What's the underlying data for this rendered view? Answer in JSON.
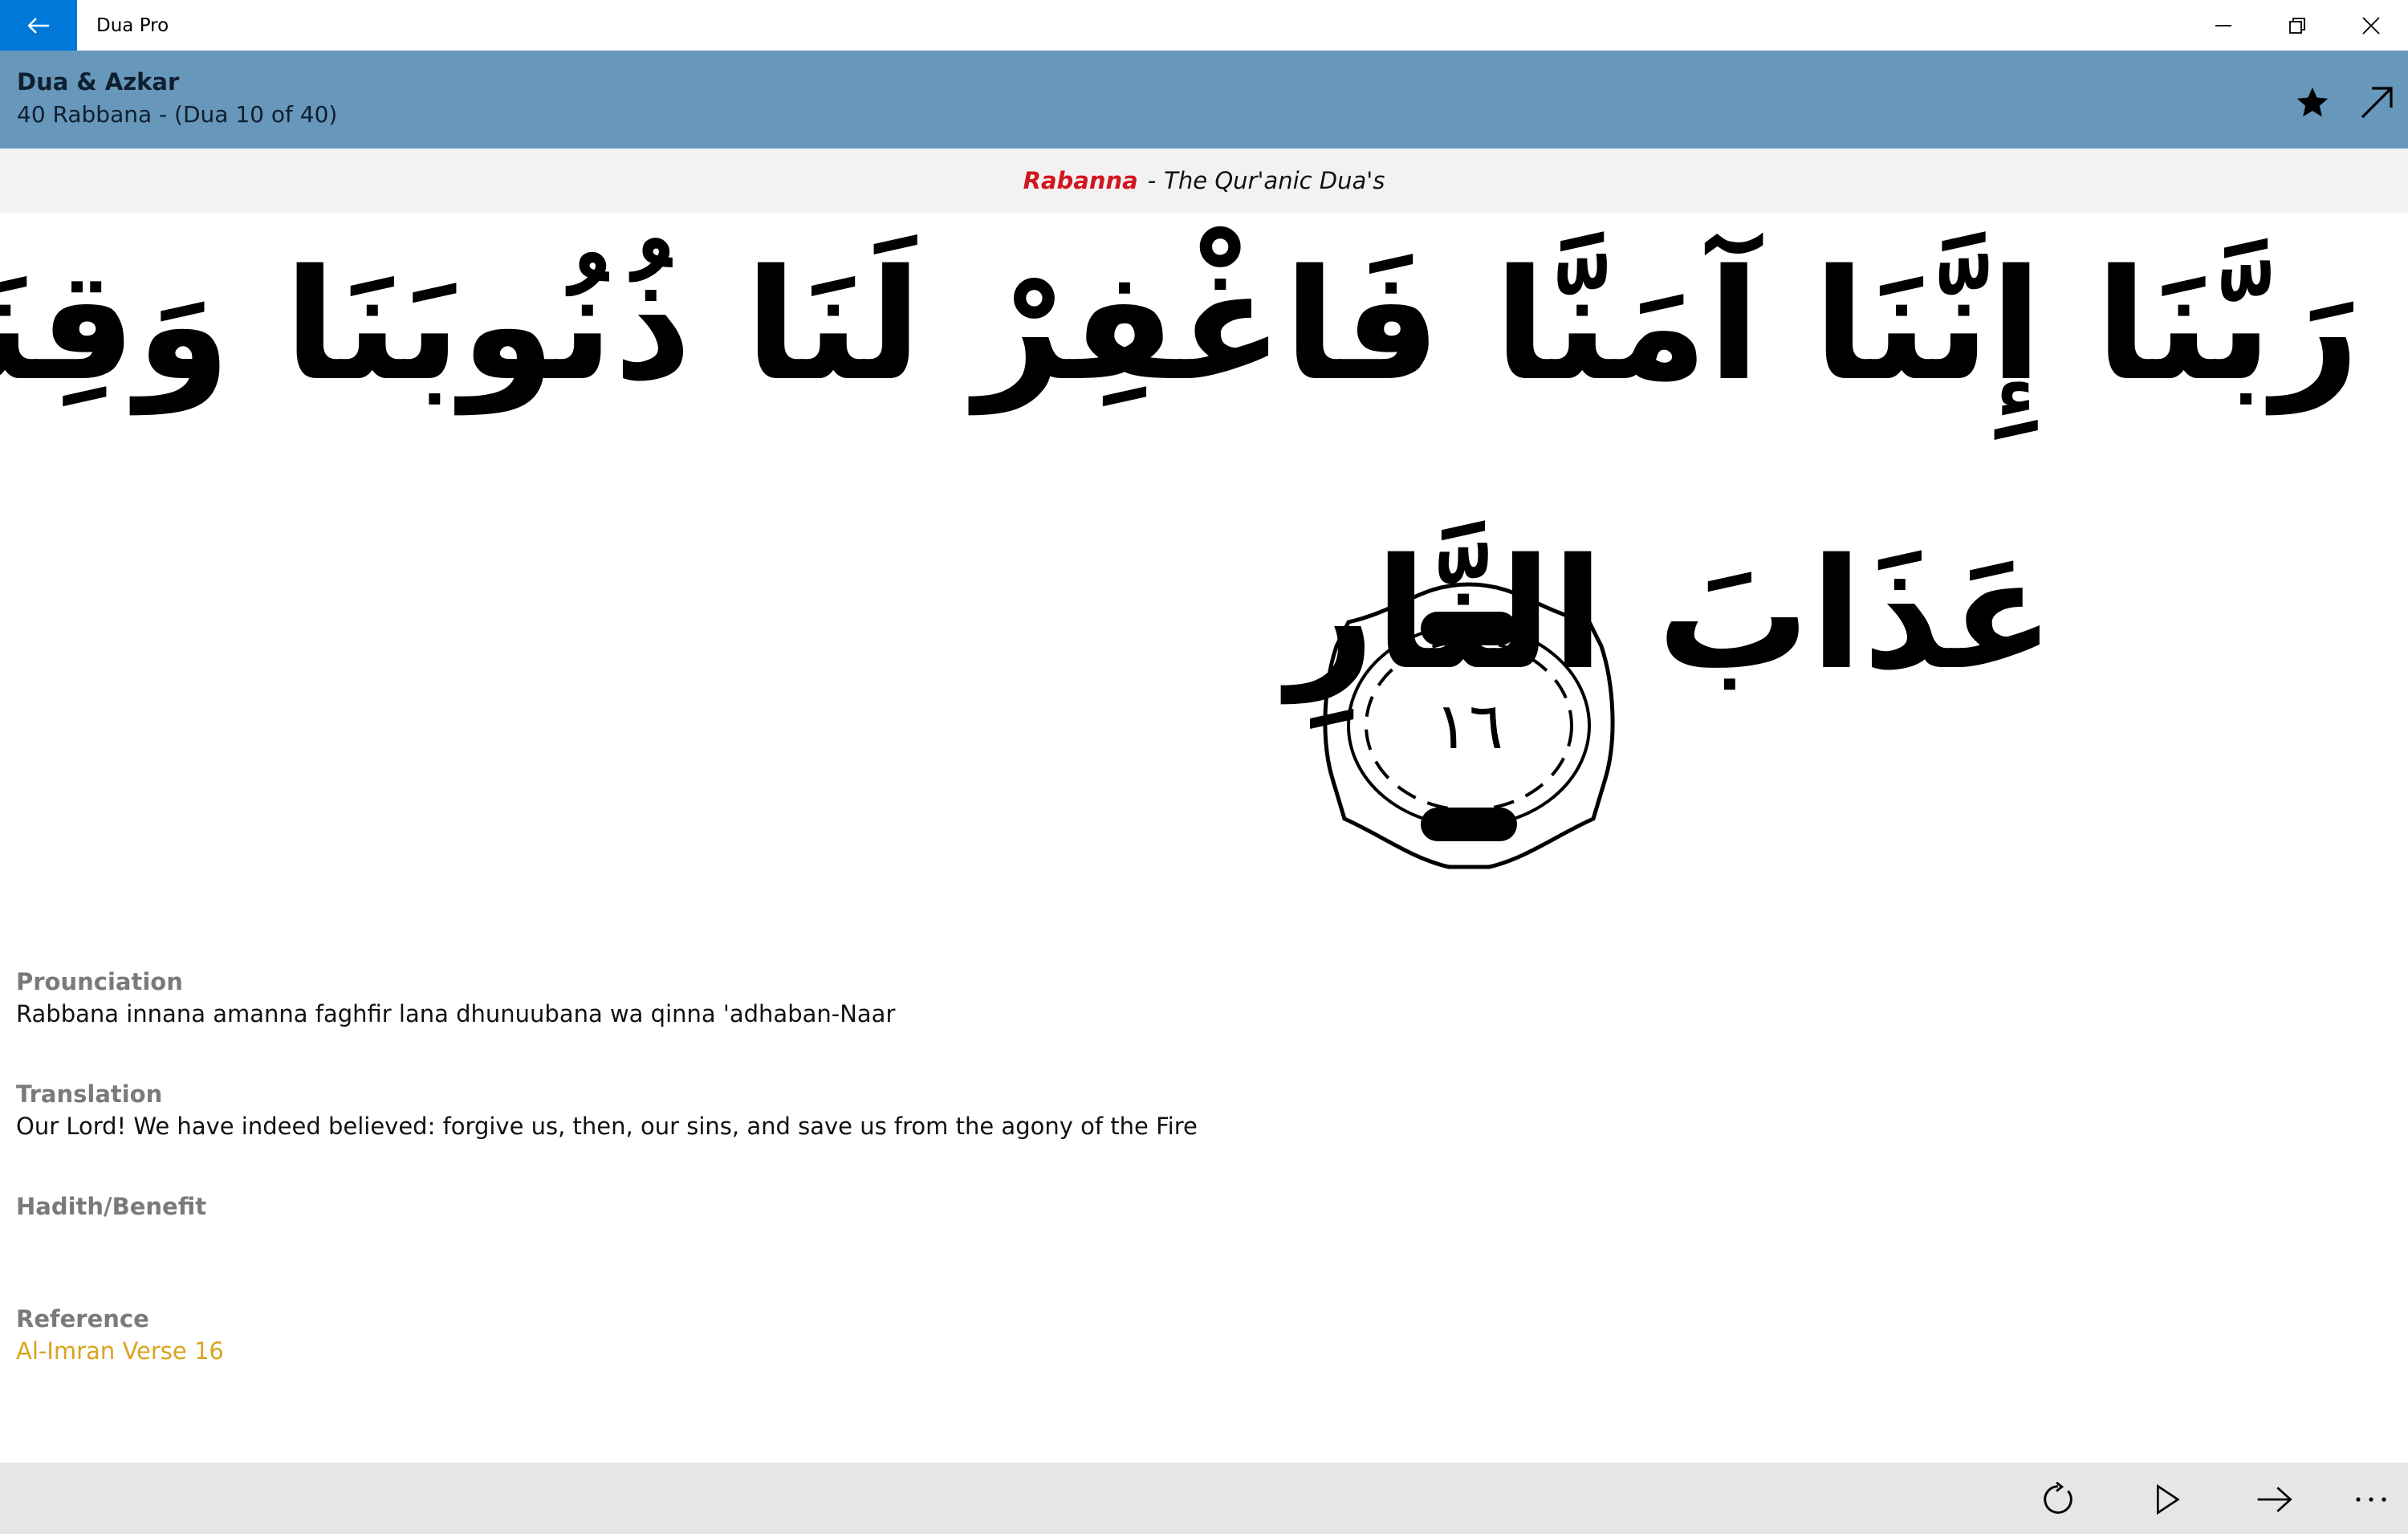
{
  "window": {
    "app_title": "Dua Pro"
  },
  "header": {
    "title": "Dua & Azkar",
    "subtitle": "40 Rabbana - (Dua 10 of 40)"
  },
  "banner": {
    "highlight": "Rabanna",
    "separator": "-",
    "text": "The Qur'anic Dua's"
  },
  "arabic": {
    "line1": "رَبَّنَا إِنَّنَا آمَنَّا فَاغْفِرْ لَنَا ذُنُوبَنَا وَقِنَا",
    "line2": "عَذَابَ النَّارِ",
    "verse_number": "١٦"
  },
  "sections": {
    "pronunciation_label": "Prounciation",
    "pronunciation_value": "Rabbana innana amanna faghfir lana dhunuubana wa qinna 'adhaban-Naar",
    "translation_label": "Translation",
    "translation_value": "Our Lord! We have indeed believed: forgive us, then, our sins, and save us from the agony of the Fire",
    "hadith_label": "Hadith/Benefit",
    "hadith_value": "",
    "reference_label": "Reference",
    "reference_value": "Al-Imran Verse 16"
  },
  "colors": {
    "accent": "#0078d7",
    "header_band": "#6797bb",
    "banner_highlight": "#d2161e",
    "reference_link": "#d9a41e"
  },
  "icons": {
    "back": "arrow-left-icon",
    "favorite": "star-icon",
    "open": "arrow-up-right-icon",
    "repeat": "refresh-icon",
    "play": "play-icon",
    "next": "arrow-right-icon",
    "more": "more-icon"
  }
}
